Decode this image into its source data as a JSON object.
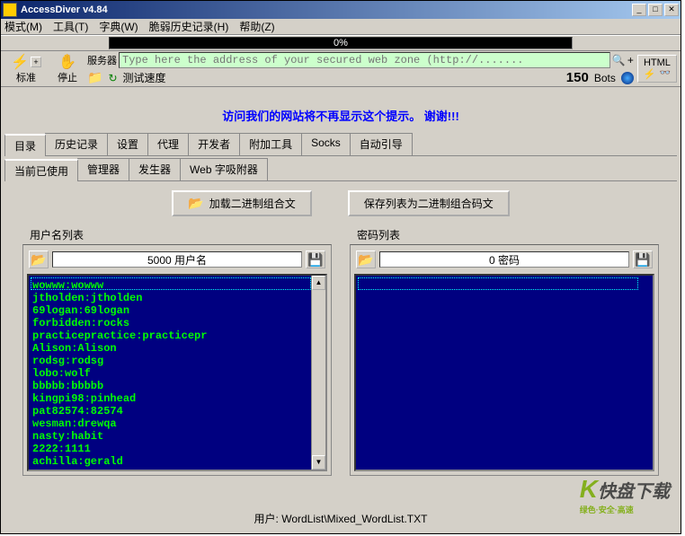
{
  "window": {
    "title": "AccessDiver v4.84"
  },
  "menu": {
    "mode": "模式(M)",
    "tools": "工具(T)",
    "dict": "字典(W)",
    "history": "脆弱历史记录(H)",
    "help": "帮助(Z)"
  },
  "progress": {
    "percent": "0%"
  },
  "toolbar": {
    "standard": "标准",
    "stop": "停止",
    "server_label": "服务器",
    "address_placeholder": "Type here the address of your secured web zone (http://.......",
    "html": "HTML",
    "test_speed": "测试速度",
    "bots_value": "150",
    "bots_label": "Bots"
  },
  "notice": "访问我们的网站将不再显示这个提示。 谢谢!!!",
  "tabs_main": {
    "t0": "目录",
    "t1": "历史记录",
    "t2": "设置",
    "t3": "代理",
    "t4": "开发者",
    "t5": "附加工具",
    "t6": "Socks",
    "t7": "自动引导"
  },
  "tabs_sub": {
    "s0": "当前已使用",
    "s1": "管理器",
    "s2": "发生器",
    "s3": "Web 字吸附器"
  },
  "buttons": {
    "load_combo": "加载二进制组合文",
    "save_combo": "保存列表为二进制组合码文"
  },
  "userlist": {
    "group": "用户名列表",
    "count": "5000 用户名",
    "items": "wowww:wowww\njtholden:jtholden\n69logan:69logan\nforbidden:rocks\npracticepractice:practicepr\nAlison:Alison\nrodsg:rodsg\nlobo:wolf\nbbbbb:bbbbb\nkingpi98:pinhead\npat82574:82574\nwesman:drewqa\nnasty:habit\n2222:1111\nachilla:gerald"
  },
  "passlist": {
    "group": "密码列表",
    "count": "0 密码"
  },
  "status": {
    "user_label": "用户:",
    "user_value": "WordList\\Mixed_WordList.TXT"
  },
  "watermark": {
    "main": "快盘下载",
    "sub": "绿色·安全·高速"
  }
}
